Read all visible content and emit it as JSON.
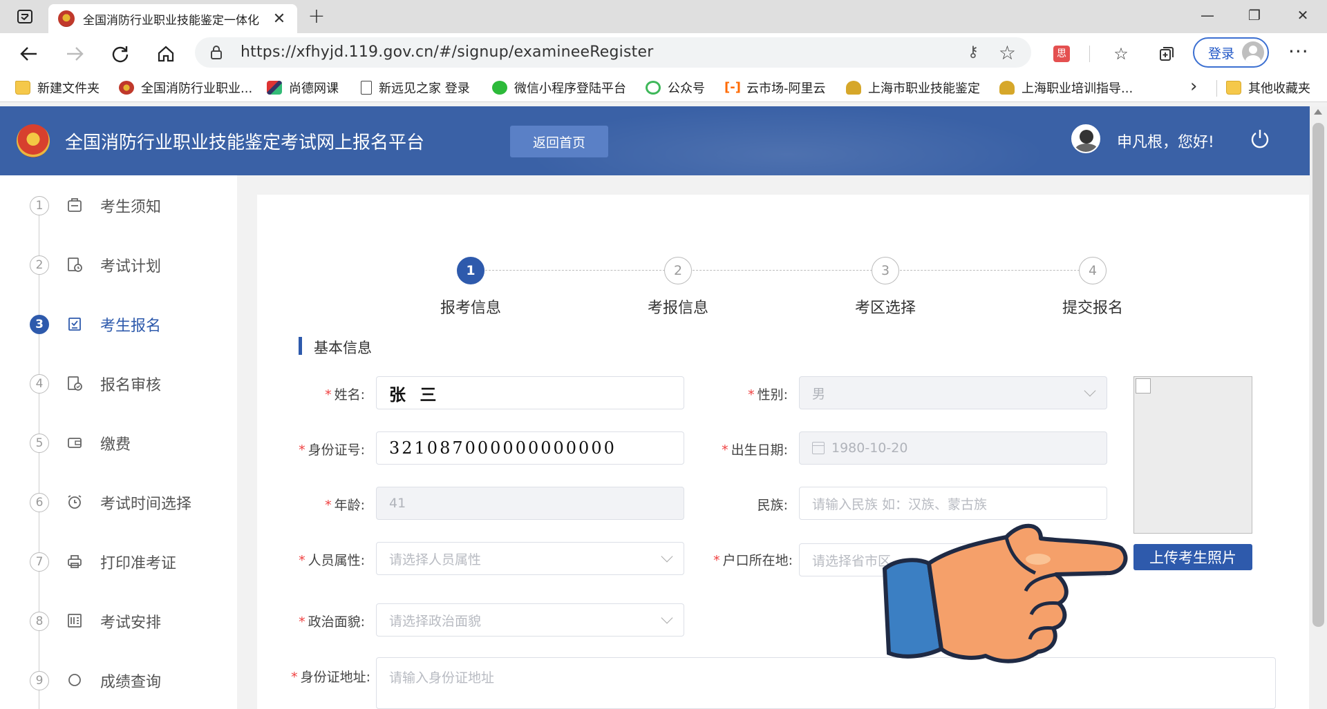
{
  "browser": {
    "tab_title": "全国消防行业职业技能鉴定一体化",
    "url": "https://xfhyjd.119.gov.cn/#/signup/examineeRegister",
    "login_label": "登录",
    "ext_badge": "思",
    "bookmarks": [
      "新建文件夹",
      "全国消防行业职业...",
      "尚德网课",
      "新远见之家 登录",
      "微信小程序登陆平台",
      "公众号",
      "云市场-阿里云",
      "上海市职业技能鉴定",
      "上海职业培训指导..."
    ],
    "other_bookmarks": "其他收藏夹"
  },
  "header": {
    "title": "全国消防行业职业技能鉴定考试网上报名平台",
    "home_button": "返回首页",
    "greeting": "申凡根，您好!"
  },
  "sidebar": {
    "active_index": 2,
    "items": [
      {
        "num": "1",
        "label": "考生须知",
        "icon": "clipboard-icon"
      },
      {
        "num": "2",
        "label": "考试计划",
        "icon": "schedule-icon"
      },
      {
        "num": "3",
        "label": "考生报名",
        "icon": "form-check-icon"
      },
      {
        "num": "4",
        "label": "报名审核",
        "icon": "review-icon"
      },
      {
        "num": "5",
        "label": "缴费",
        "icon": "wallet-icon"
      },
      {
        "num": "6",
        "label": "考试时间选择",
        "icon": "alarm-clock-icon"
      },
      {
        "num": "7",
        "label": "打印准考证",
        "icon": "printer-icon"
      },
      {
        "num": "8",
        "label": "考试安排",
        "icon": "list-icon"
      },
      {
        "num": "9",
        "label": "成绩查询",
        "icon": "search-icon"
      }
    ]
  },
  "stepper": {
    "active_index": 0,
    "steps": [
      {
        "num": "1",
        "label": "报考信息"
      },
      {
        "num": "2",
        "label": "考报信息"
      },
      {
        "num": "3",
        "label": "考区选择"
      },
      {
        "num": "4",
        "label": "提交报名"
      }
    ]
  },
  "form": {
    "section_title": "基本信息",
    "required_mark": "*",
    "name": {
      "label": "姓名:",
      "value": "张 三"
    },
    "gender": {
      "label": "性别:",
      "value": "男"
    },
    "id_number": {
      "label": "身份证号:",
      "value": "321087000000000000"
    },
    "birth_date": {
      "label": "出生日期:",
      "value": "1980-10-20"
    },
    "age": {
      "label": "年龄:",
      "value": "41"
    },
    "ethnicity": {
      "label": "民族:",
      "placeholder": "请输入民族 如：汉族、蒙古族"
    },
    "person_type": {
      "label": "人员属性:",
      "placeholder": "请选择人员属性"
    },
    "household": {
      "label": "户口所在地:",
      "placeholder": "请选择省市区"
    },
    "political": {
      "label": "政治面貌:",
      "placeholder": "请选择政治面貌"
    },
    "id_address": {
      "label": "身份证地址:",
      "placeholder": "请输入身份证地址"
    },
    "upload_button": "上传考生照片"
  },
  "colors": {
    "primary": "#2e5aac",
    "header_bg": "#3a61a6",
    "required": "#f04040"
  }
}
